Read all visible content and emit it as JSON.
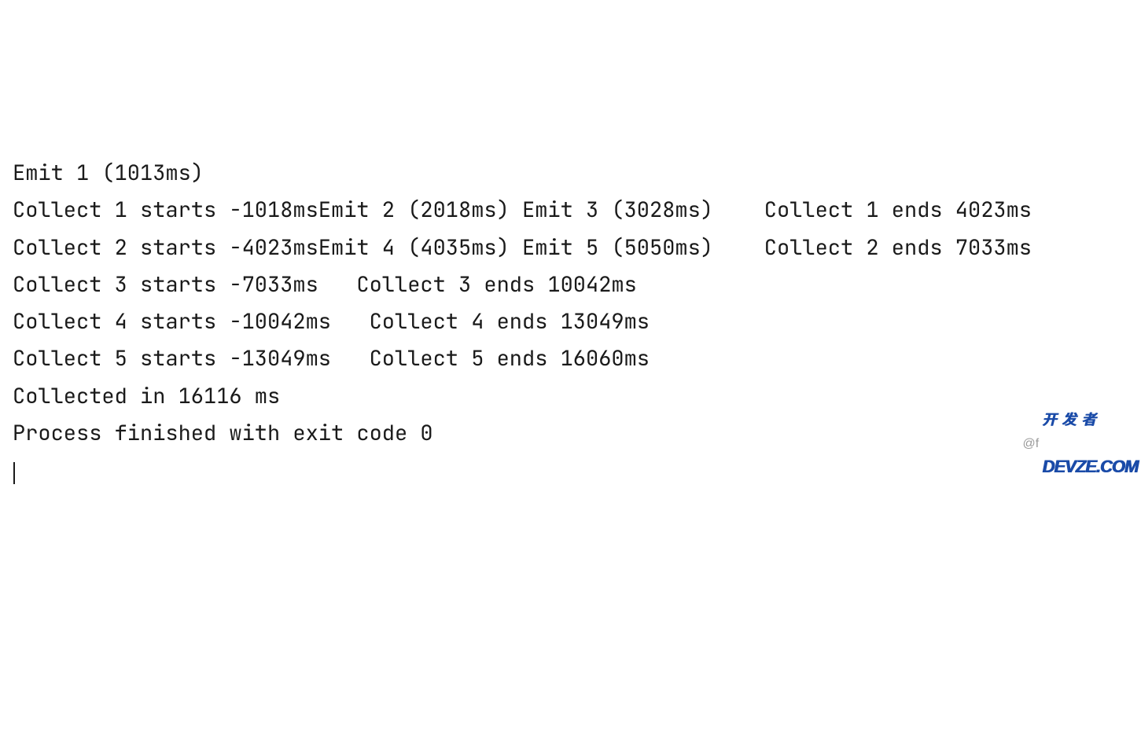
{
  "console": {
    "lines": [
      "Emit 1 (1013ms)",
      "Collect 1 starts -1018msEmit 2 (2018ms) Emit 3 (3028ms)    Collect 1 ends 4023ms",
      "",
      "Collect 2 starts -4023msEmit 4 (4035ms) Emit 5 (5050ms)    Collect 2 ends 7033ms",
      "",
      "Collect 3 starts -7033ms   Collect 3 ends 10042ms",
      "",
      "Collect 4 starts -10042ms   Collect 4 ends 13049ms",
      "",
      "Collect 5 starts -13049ms   Collect 5 ends 16060ms",
      "",
      "Collected in 16116 ms",
      "Process finished with exit code 0"
    ]
  },
  "watermark": {
    "at": "@f",
    "top": "开 发 者",
    "bottom": "DEVZE.COM"
  }
}
